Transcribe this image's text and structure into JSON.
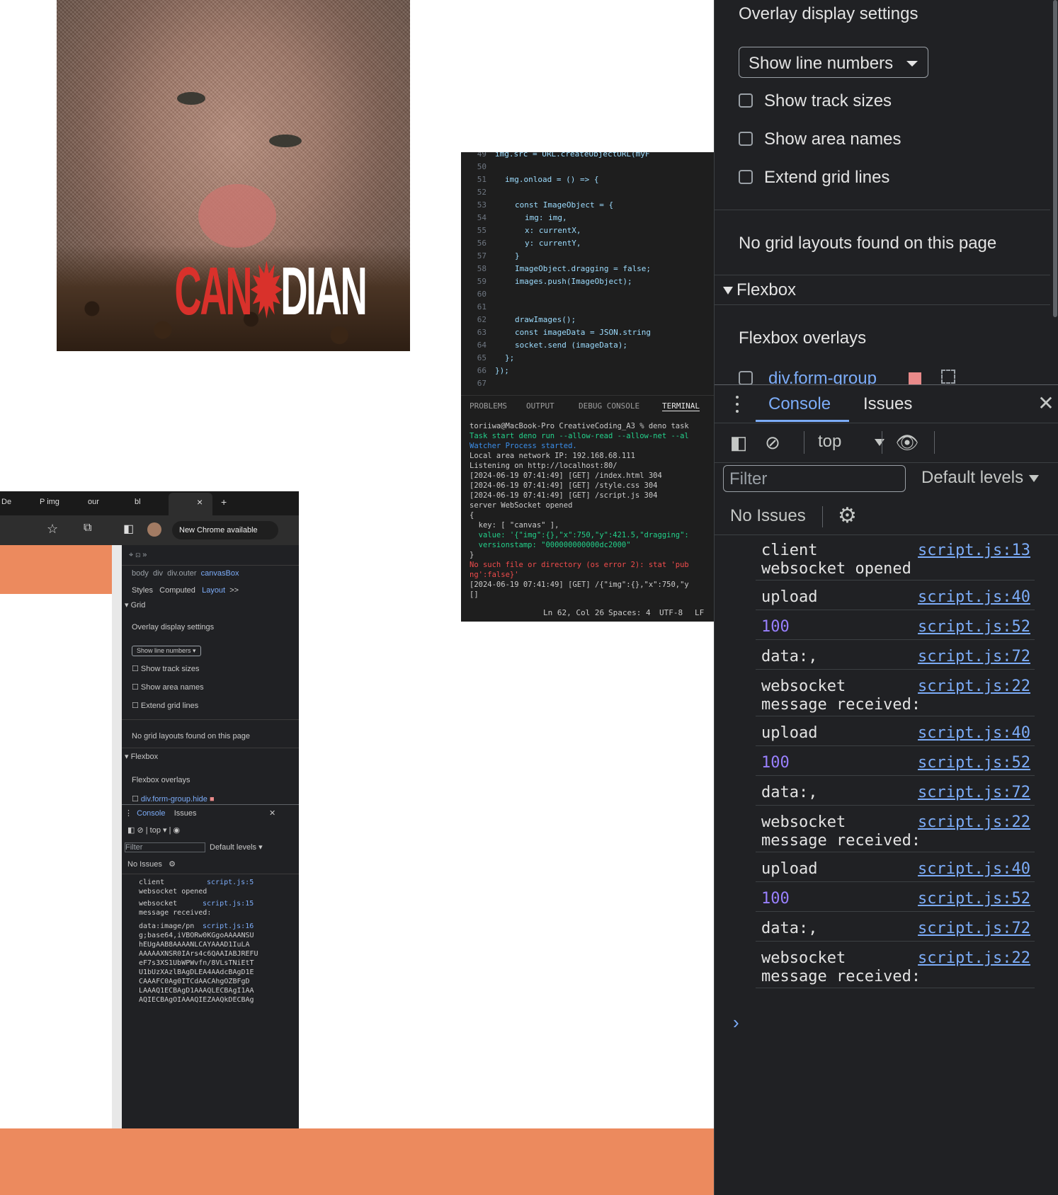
{
  "canvas": {
    "cat_image": {
      "brand_left": "CAN",
      "brand_right": "DIAN"
    },
    "code_image": {
      "code_lines": [
        {
          "n": "49",
          "text": "img.src = URL.createObjectURL(myF"
        },
        {
          "n": "50",
          "text": ""
        },
        {
          "n": "51",
          "text": "img.onload = () => {"
        },
        {
          "n": "52",
          "text": ""
        },
        {
          "n": "53",
          "text": "const ImageObject = {"
        },
        {
          "n": "54",
          "text": "img: img,"
        },
        {
          "n": "55",
          "text": "x: currentX,"
        },
        {
          "n": "56",
          "text": "y: currentY,"
        },
        {
          "n": "57",
          "text": "}"
        },
        {
          "n": "58",
          "text": "ImageObject.dragging = false;"
        },
        {
          "n": "59",
          "text": "images.push(ImageObject);"
        },
        {
          "n": "60",
          "text": ""
        },
        {
          "n": "61",
          "text": ""
        },
        {
          "n": "62",
          "text": "drawImages();"
        },
        {
          "n": "63",
          "text": "const imageData = JSON.string"
        },
        {
          "n": "64",
          "text": "socket.send (imageData);"
        },
        {
          "n": "65",
          "text": "};"
        },
        {
          "n": "66",
          "text": "});"
        },
        {
          "n": "67",
          "text": ""
        }
      ],
      "terminal_tabs": [
        "PROBLEMS",
        "OUTPUT",
        "DEBUG CONSOLE",
        "TERMINAL"
      ],
      "terminal_lines": [
        "toriiwa@MacBook-Pro CreativeCoding_A3 % deno task",
        "Task start deno run --allow-read --allow-net --al",
        "Watcher Process started.",
        "Local area network IP: 192.168.68.111",
        "Listening on http://localhost:80/",
        "[2024-06-19 07:41:49] [GET] /index.html 304",
        "[2024-06-19 07:41:49] [GET] /style.css 304",
        "[2024-06-19 07:41:49] [GET] /script.js 304",
        "server WebSocket opened",
        "{",
        "  key: [ \"canvas\" ],",
        "  value: '{\"img\":{},\"x\":750,\"y\":421.5,\"dragging\":",
        "  versionstamp: \"000000000000dc2000\"",
        "}",
        "No such file or directory (os error 2): stat 'pub",
        "ng':false}'",
        "[2024-06-19 07:41:49] [GET] /{\"img\":{},\"x\":750,\"y",
        "[]"
      ],
      "status": [
        "Ln 62, Col 26",
        "Spaces: 4",
        "UTF-8",
        "LF"
      ]
    },
    "browser_image": {
      "tabs": [
        "De",
        "P img",
        "our",
        "bl",
        "×",
        "+"
      ],
      "chrome_button": "New Chrome available",
      "breadcrumbs": [
        "body",
        "div",
        "div.outer",
        "canvasBox"
      ],
      "panel_tabs": [
        "Styles",
        "Computed",
        "Layout",
        ">>"
      ],
      "grid_label": "Grid",
      "overlay_heading": "Overlay display settings",
      "select_value": "Show line numbers",
      "checks": [
        "Show track sizes",
        "Show area names",
        "Extend grid lines"
      ],
      "no_grid": "No grid layouts found on this page",
      "flexbox": "Flexbox",
      "flexbox_overlays": "Flexbox overlays",
      "flex_item": "div.form-group.hide",
      "console_tabs": [
        "Console",
        "Issues"
      ],
      "context": "top",
      "filter": "Filter",
      "levels": "Default levels",
      "no_issues": "No Issues",
      "log": [
        {
          "text": "client\nwebsocket opened",
          "src": "script.js:5"
        },
        {
          "text": "websocket\nmessage received:",
          "src": "script.js:15"
        },
        {
          "text": "data:image/pn\ng;base64,iVBORw0KGgoAAAANSU\nhEUgAAB8AAAANLCAYAAAD1IuLA\nAAAAAXNSR0IArs4c6QAAIABJREFU\neF7s3XS1UbWPWvfn/8VLsTNiEtT\nU1bUzXAzlBAgDLEA4AAdcBAgD1E\nCAAAFC0Ag0ITCdAACAhgOZBFgD\nLAAAQ1ECBAgD1AAAQLECBAgI1AA\nAQIECBAgOIAAAQIEZAAQkDECBAg",
          "src": "script.js:16"
        }
      ]
    }
  },
  "devtools": {
    "layout": {
      "overlay_heading": "Overlay display settings",
      "select_value": "Show line numbers",
      "checks": [
        "Show track sizes",
        "Show area names",
        "Extend grid lines"
      ],
      "no_grid_message": "No grid layouts found on this page",
      "flexbox_section": "Flexbox",
      "flexbox_overlays": "Flexbox overlays",
      "flex_item": "div.form-group",
      "flex_item_color": "#e98a8a"
    },
    "drawer": {
      "tabs": [
        "Console",
        "Issues"
      ],
      "context": "top",
      "filter_placeholder": "Filter",
      "levels": "Default levels",
      "no_issues": "No Issues",
      "messages": [
        {
          "text": "client\nwebsocket opened",
          "src": "script.js:13"
        },
        {
          "text": "upload",
          "src": "script.js:40"
        },
        {
          "text": "100",
          "src": "script.js:52"
        },
        {
          "text": "data:,",
          "src": "script.js:72"
        },
        {
          "text": "websocket\nmessage received:",
          "src": "script.js:22"
        },
        {
          "text": "upload",
          "src": "script.js:40"
        },
        {
          "text": "100",
          "src": "script.js:52"
        },
        {
          "text": "data:,",
          "src": "script.js:72"
        },
        {
          "text": "websocket\nmessage received:",
          "src": "script.js:22"
        },
        {
          "text": "upload",
          "src": "script.js:40"
        },
        {
          "text": "100",
          "src": "script.js:52"
        },
        {
          "text": "data:,",
          "src": "script.js:72"
        },
        {
          "text": "websocket\nmessage received:",
          "src": "script.js:22"
        }
      ],
      "prompt": "›"
    }
  },
  "colors": {
    "accent": "#7cacf8",
    "page_orange": "#ec8a5e",
    "devtools_bg": "#202124",
    "number": "#9980ff"
  }
}
